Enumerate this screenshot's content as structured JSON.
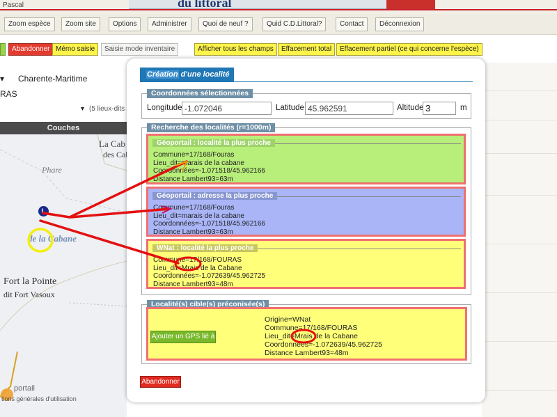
{
  "header": {
    "user": "Pascal",
    "site_banner": "du littoral"
  },
  "nav": [
    "Zoom espèce",
    "Zoom site",
    "Options",
    "Administrer",
    "Quoi de neuf ?",
    "Quid C.D.Littoral?",
    "Contact",
    "Déconnexion"
  ],
  "actions": {
    "abandon": "Abandonner",
    "memo": "Mémo saisie",
    "inventory_mode": "Saisie mode inventaire",
    "show_all": "Afficher tous les champs",
    "clear_total": "Effacement total",
    "clear_partial": "Effacement partiel (ce qui concerne l'espèce)"
  },
  "left": {
    "region": "Charente-Maritime",
    "commune_partial": "RAS",
    "lieux_dits": "(5 lieux-dits",
    "layers_tab": "Couches"
  },
  "map": {
    "labels": [
      "La Cab",
      "des Cab",
      "Phare",
      "de la Cabane",
      "Fort la Pointe",
      "dit Fort Vasoux"
    ],
    "marker": "L",
    "footer_logo": "portail",
    "footer_terms": "tions générales d'utilisation"
  },
  "modal": {
    "title_highlight": "Création",
    "title_rest": " d'une localité",
    "coords": {
      "legend": "Coordonnées sélectionnées",
      "longitude_label": "Longitude",
      "longitude_value": "-1.072046",
      "latitude_label": "Latitude",
      "latitude_value": "45.962591",
      "altitude_label": "Altitude",
      "altitude_value": "3",
      "altitude_unit": "m"
    },
    "search": {
      "legend": "Recherche des localités (r=1000m)",
      "results": [
        {
          "title": "Géoportail : localité la plus proche",
          "lines": [
            "Commune=17/168/Fouras",
            "Lieu_dit=marais de la cabane",
            "Coordonnées=-1.071518/45.962166",
            "Distance Lambert93=63m"
          ]
        },
        {
          "title": "Géoportail : adresse la plus proche",
          "lines": [
            "Commune=17/168/Fouras",
            "Lieu_dit=marais de la cabane",
            "Coordonnées=-1.071518/45.962166",
            "Distance Lambert93=63m"
          ]
        },
        {
          "title": "WNat : localité la plus proche",
          "lines": [
            "Commune=17/168/FOURAS",
            "Lieu_dit=Mrais de la Cabane",
            "Coordonnées=-1.072639/45.962725",
            "Distance Lambert93=48m"
          ]
        }
      ]
    },
    "targets": {
      "legend": "Localité(s) cible(s) préconisée(s)",
      "gps_button": "Ajouter un GPS lié à",
      "lines": [
        "Origine=WNat",
        "Commune=17/168/FOURAS",
        "Lieu_dit=Mrais de la Cabane",
        "Coordonnées=-1.072639/45.962725",
        "Distance Lambert93=48m"
      ]
    },
    "abandon": "Abandonner"
  },
  "colors": {
    "green_box": "#b8ee7a",
    "blue_box": "#a9b5f7",
    "yellow_box": "#ffff7a",
    "box_border": "#f07070",
    "annotation_red": "#e41010",
    "annotation_yellow": "#f4ee10",
    "title_blue": "#1f77b5"
  }
}
